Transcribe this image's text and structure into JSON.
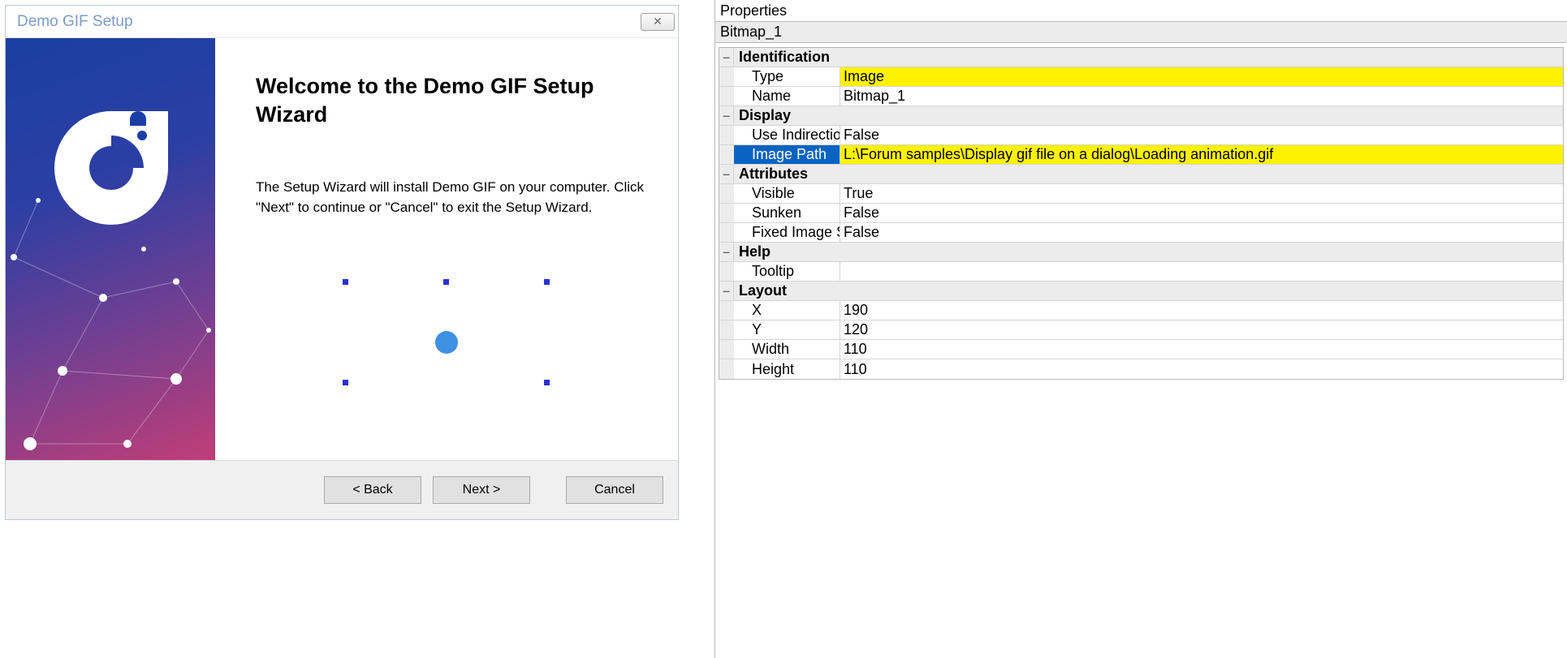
{
  "dialog": {
    "title": "Demo GIF Setup",
    "heading": "Welcome to the Demo GIF Setup Wizard",
    "body": "The Setup Wizard will install Demo GIF on your computer. Click \"Next\" to continue or \"Cancel\" to exit the Setup Wizard.",
    "buttons": {
      "back": "<  Back",
      "next": "Next  >",
      "cancel": "Cancel"
    }
  },
  "properties": {
    "title": "Properties",
    "object": "Bitmap_1",
    "groups": [
      {
        "name": "Identification",
        "rows": [
          {
            "label": "Type",
            "value": "Image",
            "highlightValue": true
          },
          {
            "label": "Name",
            "value": "Bitmap_1"
          }
        ]
      },
      {
        "name": "Display",
        "rows": [
          {
            "label": "Use Indirection",
            "value": "False"
          },
          {
            "label": "Image Path",
            "value": "L:\\Forum samples\\Display gif file on a dialog\\Loading animation.gif",
            "selected": true,
            "highlightValue": true
          }
        ]
      },
      {
        "name": "Attributes",
        "rows": [
          {
            "label": "Visible",
            "value": "True"
          },
          {
            "label": "Sunken",
            "value": "False"
          },
          {
            "label": "Fixed Image Size",
            "value": "False"
          }
        ]
      },
      {
        "name": "Help",
        "rows": [
          {
            "label": "Tooltip",
            "value": ""
          }
        ]
      },
      {
        "name": "Layout",
        "rows": [
          {
            "label": "X",
            "value": "190"
          },
          {
            "label": "Y",
            "value": "120"
          },
          {
            "label": "Width",
            "value": "110"
          },
          {
            "label": "Height",
            "value": "110"
          }
        ]
      }
    ]
  }
}
